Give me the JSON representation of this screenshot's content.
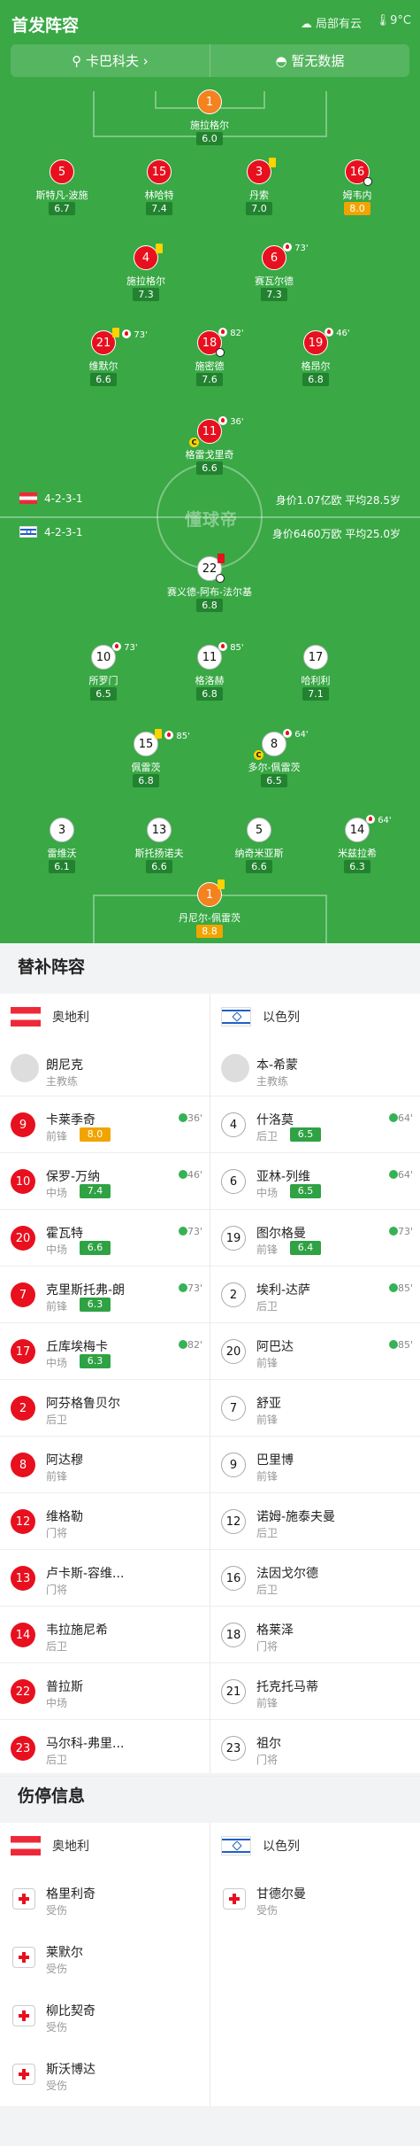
{
  "header": {
    "title": "首发阵容",
    "weather": "局部有云",
    "temp": "9°C"
  },
  "coachbar": {
    "home_coach": "卡巴科夫",
    "away": "暂无数据"
  },
  "colors": {
    "pitch": "#39a845",
    "red": "#e8101e",
    "score_bg": "#22822f",
    "score_high": "#f1a400"
  },
  "home": {
    "formation": "4-2-3-1",
    "info": "身价1.07亿欧  平均28.5岁",
    "players": [
      {
        "num": "1",
        "name": "施拉格尔",
        "score": "6.0",
        "kit": "o"
      },
      {
        "num": "5",
        "name": "斯特凡-波施",
        "score": "6.7",
        "kit": "r"
      },
      {
        "num": "15",
        "name": "林哈特",
        "score": "7.4",
        "kit": "r"
      },
      {
        "num": "3",
        "name": "丹索",
        "score": "7.0",
        "kit": "r"
      },
      {
        "num": "16",
        "name": "姆韦内",
        "score": "8.0",
        "kit": "r",
        "high": true
      },
      {
        "num": "4",
        "name": "施拉格尔",
        "score": "7.3",
        "kit": "r"
      },
      {
        "num": "6",
        "name": "赛瓦尔德",
        "score": "7.3",
        "kit": "r"
      },
      {
        "num": "21",
        "name": "维默尔",
        "score": "6.6",
        "kit": "r"
      },
      {
        "num": "18",
        "name": "施密德",
        "score": "7.6",
        "kit": "r"
      },
      {
        "num": "19",
        "name": "格昂尔",
        "score": "6.8",
        "kit": "r"
      },
      {
        "num": "11",
        "name": "格雷戈里奇",
        "score": "6.6",
        "kit": "r"
      }
    ],
    "events": {
      "p6": "73'",
      "p21": "73'",
      "p18": "82'",
      "p19": "46'",
      "p11": "36'"
    }
  },
  "away": {
    "formation": "4-2-3-1",
    "info": "身价6460万欧  平均25.0岁",
    "players": [
      {
        "num": "22",
        "name": "赛义德-阿布-法尔基",
        "score": "6.8",
        "kit": "w"
      },
      {
        "num": "10",
        "name": "所罗门",
        "score": "6.5",
        "kit": "w"
      },
      {
        "num": "11",
        "name": "格洛赫",
        "score": "6.8",
        "kit": "w"
      },
      {
        "num": "17",
        "name": "哈利利",
        "score": "7.1",
        "kit": "w"
      },
      {
        "num": "15",
        "name": "佩雷茨",
        "score": "6.8",
        "kit": "w"
      },
      {
        "num": "8",
        "name": "多尔-佩雷茨",
        "score": "6.5",
        "kit": "w"
      },
      {
        "num": "3",
        "name": "雷维沃",
        "score": "6.1",
        "kit": "w"
      },
      {
        "num": "13",
        "name": "斯托扬诺夫",
        "score": "6.6",
        "kit": "w"
      },
      {
        "num": "5",
        "name": "纳奇米亚斯",
        "score": "6.6",
        "kit": "w"
      },
      {
        "num": "14",
        "name": "米兹拉希",
        "score": "6.3",
        "kit": "w"
      },
      {
        "num": "1",
        "name": "丹尼尔-佩雷茨",
        "score": "8.8",
        "kit": "o",
        "high": true
      }
    ],
    "events": {
      "p10": "73'",
      "p11": "85'",
      "p15": "85'",
      "p8": "64'",
      "p14": "64'"
    }
  },
  "watermark": "懂球帝",
  "subs": {
    "title": "替补阵容",
    "home_team": "奥地利",
    "away_team": "以色列",
    "home_coach": {
      "name": "朗尼克",
      "role": "主教练"
    },
    "away_coach": {
      "name": "本-希蒙",
      "role": "主教练"
    },
    "home": [
      {
        "num": "9",
        "name": "卡莱季奇",
        "pos": "前锋",
        "score": "8.0",
        "high": true,
        "evt": "36'"
      },
      {
        "num": "10",
        "name": "保罗-万纳",
        "pos": "中场",
        "score": "7.4",
        "evt": "46'"
      },
      {
        "num": "20",
        "name": "霍瓦特",
        "pos": "中场",
        "score": "6.6",
        "evt": "73'"
      },
      {
        "num": "7",
        "name": "克里斯托弗-朗",
        "pos": "前锋",
        "score": "6.3",
        "evt": "73'"
      },
      {
        "num": "17",
        "name": "丘库埃梅卡",
        "pos": "中场",
        "score": "6.3",
        "evt": "82'"
      },
      {
        "num": "2",
        "name": "阿芬格鲁贝尔",
        "pos": "后卫"
      },
      {
        "num": "8",
        "name": "阿达穆",
        "pos": "前锋"
      },
      {
        "num": "12",
        "name": "维格勒",
        "pos": "门将"
      },
      {
        "num": "13",
        "name": "卢卡斯-容维...",
        "pos": "门将"
      },
      {
        "num": "14",
        "name": "韦拉施尼希",
        "pos": "后卫"
      },
      {
        "num": "22",
        "name": "普拉斯",
        "pos": "中场"
      },
      {
        "num": "23",
        "name": "马尔科-弗里...",
        "pos": "后卫"
      }
    ],
    "away": [
      {
        "num": "4",
        "name": "什洛莫",
        "pos": "后卫",
        "score": "6.5",
        "evt": "64'"
      },
      {
        "num": "6",
        "name": "亚林-列维",
        "pos": "中场",
        "score": "6.5",
        "evt": "64'"
      },
      {
        "num": "19",
        "name": "图尔格曼",
        "pos": "前锋",
        "score": "6.4",
        "evt": "73'"
      },
      {
        "num": "2",
        "name": "埃利-达萨",
        "pos": "后卫",
        "evt": "85'"
      },
      {
        "num": "20",
        "name": "阿巴达",
        "pos": "前锋",
        "evt": "85'"
      },
      {
        "num": "7",
        "name": "舒亚",
        "pos": "前锋"
      },
      {
        "num": "9",
        "name": "巴里博",
        "pos": "前锋"
      },
      {
        "num": "12",
        "name": "诺姆-施泰夫曼",
        "pos": "后卫"
      },
      {
        "num": "16",
        "name": "法因戈尔德",
        "pos": "后卫"
      },
      {
        "num": "18",
        "name": "格莱泽",
        "pos": "门将"
      },
      {
        "num": "21",
        "name": "托克托马蒂",
        "pos": "前锋"
      },
      {
        "num": "23",
        "name": "祖尔",
        "pos": "门将"
      }
    ]
  },
  "injuries": {
    "title": "伤停信息",
    "home_team": "奥地利",
    "away_team": "以色列",
    "home": [
      {
        "name": "格里利奇",
        "status": "受伤"
      },
      {
        "name": "莱默尔",
        "status": "受伤"
      },
      {
        "name": "柳比契奇",
        "status": "受伤"
      },
      {
        "name": "斯沃博达",
        "status": "受伤"
      }
    ],
    "away": [
      {
        "name": "甘德尔曼",
        "status": "受伤"
      }
    ]
  }
}
